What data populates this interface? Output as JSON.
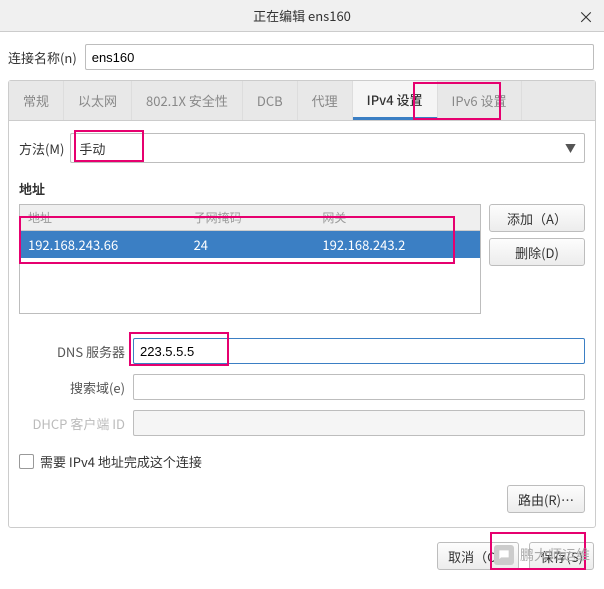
{
  "window": {
    "title": "正在编辑 ens160",
    "close": "×"
  },
  "connection": {
    "label": "连接名称(n)",
    "value": "ens160"
  },
  "tabs": {
    "general": "常规",
    "ethernet": "以太网",
    "security": "802.1X 安全性",
    "dcb": "DCB",
    "proxy": "代理",
    "ipv4": "IPv4 设置",
    "ipv6": "IPv6 设置"
  },
  "method": {
    "label": "方法(M)",
    "value": "手动"
  },
  "addresses": {
    "section": "地址",
    "headers": {
      "addr": "地址",
      "mask": "子网掩码",
      "gw": "网关"
    },
    "rows": [
      {
        "addr": "192.168.243.66",
        "mask": "24",
        "gw": "192.168.243.2"
      }
    ],
    "add": "添加（A）",
    "delete": "删除(D)"
  },
  "fields": {
    "dns_label": "DNS 服务器",
    "dns_value": "223.5.5.5",
    "search_label": "搜索域(e)",
    "search_value": "",
    "dhcp_label": "DHCP 客户端 ID",
    "dhcp_value": ""
  },
  "checkbox": {
    "label": "需要 IPv4 地址完成这个连接"
  },
  "routes": {
    "label": "路由(R)…"
  },
  "footer": {
    "cancel": "取消（C）",
    "save": "保存(S)"
  },
  "watermark": "鹏大师运维"
}
